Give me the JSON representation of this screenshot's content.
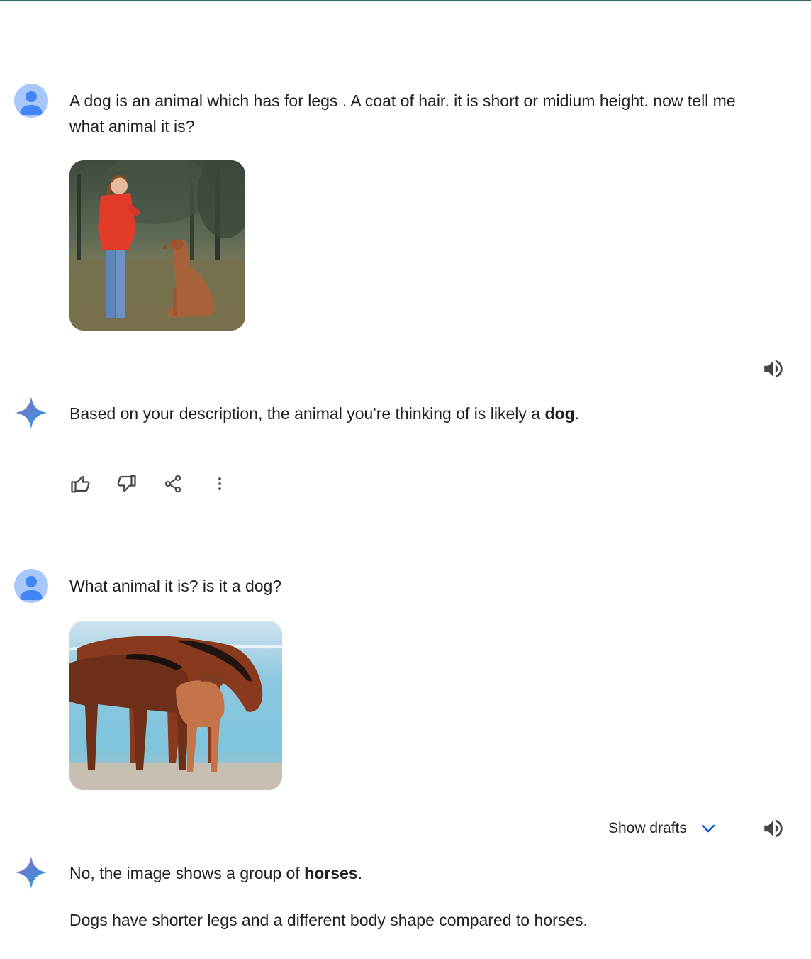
{
  "conversation": {
    "turns": [
      {
        "role": "user",
        "avatar_icon": "person-icon",
        "text": "A dog is an animal which has for legs . A coat of hair. it is short or midium height. now tell me what animal it is?",
        "image": "woman-training-dog-photo"
      },
      {
        "role": "assistant",
        "icon": "gemini-sparkle-icon",
        "text_before": "Based on your description, the animal you're thinking of is likely a ",
        "text_bold": "dog",
        "text_after": ".",
        "actions": [
          "thumbs-up-icon",
          "thumbs-down-icon",
          "share-icon",
          "more-vert-icon"
        ]
      },
      {
        "role": "user",
        "avatar_icon": "person-icon",
        "text": "What animal it is? is it a dog?",
        "image": "horses-on-beach-photo"
      },
      {
        "role": "assistant",
        "icon": "gemini-sparkle-icon",
        "show_drafts_label": "Show drafts",
        "p1_before": "No, the image shows a group of ",
        "p1_bold": "horses",
        "p1_after": ".",
        "p2": "Dogs have shorter legs and a different body shape compared to horses."
      }
    ]
  },
  "colors": {
    "avatar_bg": "#a8c7fa",
    "avatar_fg": "#4285f4",
    "text": "#1f1f1f",
    "icon": "#444746",
    "accent_chevron": "#0b57d0"
  }
}
